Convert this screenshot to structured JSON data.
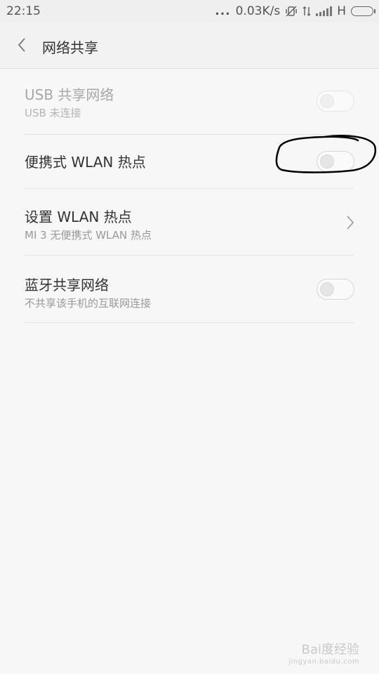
{
  "status_bar": {
    "time": "22:15",
    "dots": "...",
    "speed": "0.03K/s",
    "network_type": "H",
    "icons": [
      "more-dots-icon",
      "vibrate-off-icon",
      "data-transfer-icon",
      "signal-icon",
      "battery-icon"
    ]
  },
  "header": {
    "title": "网络共享",
    "back_icon": "chevron-left-icon"
  },
  "settings": [
    {
      "title": "USB 共享网络",
      "subtitle": "USB 未连接",
      "control": "toggle",
      "enabled": false,
      "on": false
    },
    {
      "title": "便携式 WLAN 热点",
      "subtitle": "",
      "control": "toggle",
      "enabled": true,
      "on": false
    },
    {
      "title": "设置 WLAN 热点",
      "subtitle": "MI 3 无便携式 WLAN 热点",
      "control": "chevron"
    },
    {
      "title": "蓝牙共享网络",
      "subtitle": "不共享该手机的互联网连接",
      "control": "toggle",
      "enabled": true,
      "on": false
    }
  ],
  "watermark": {
    "brand": "Bai度经验",
    "url": "jingyan.baidu.com"
  },
  "colors": {
    "background": "#f7f7f7",
    "header_background": "#f2f2f2",
    "divider": "#e2e2e2",
    "annotation": "#000000"
  }
}
